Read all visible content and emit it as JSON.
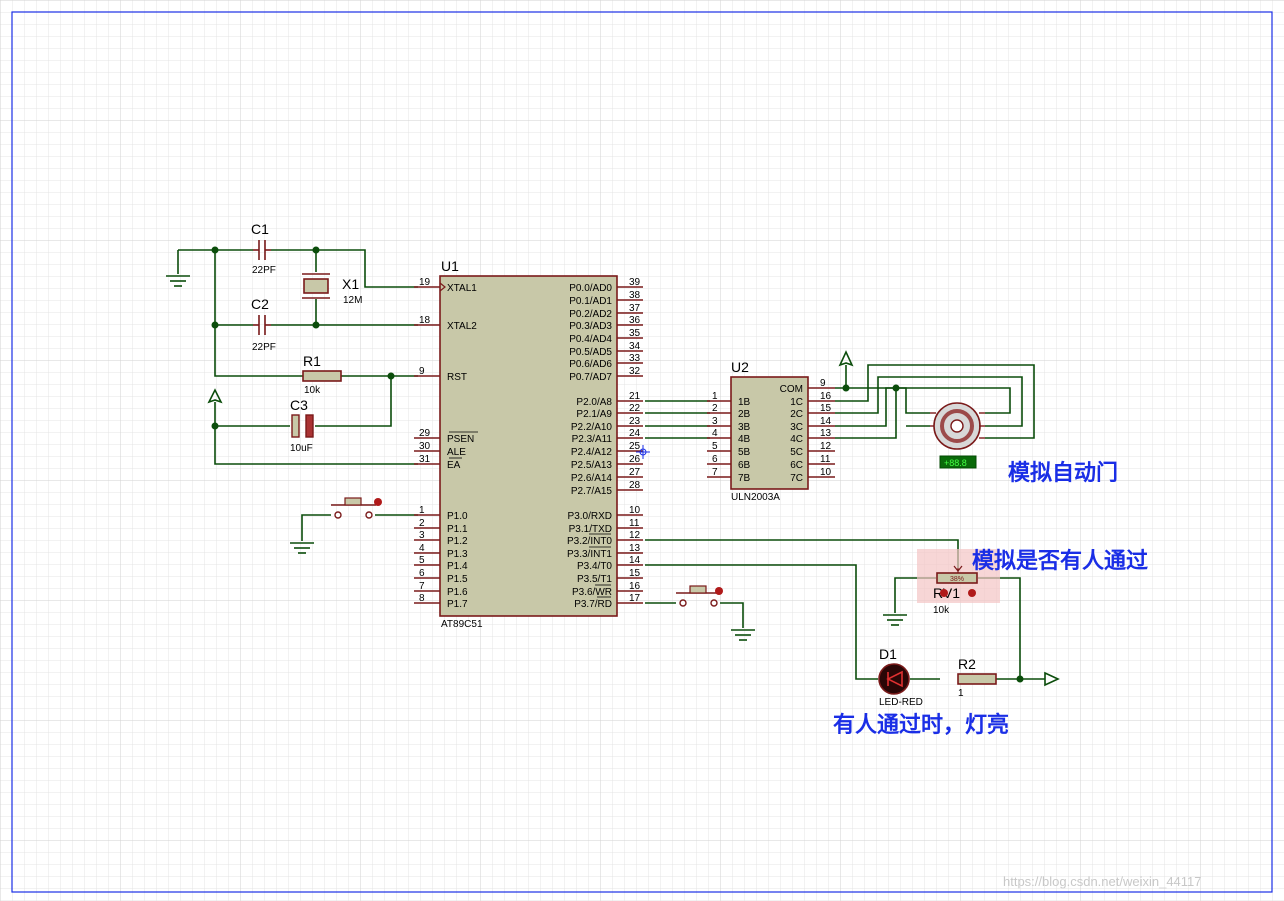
{
  "components": {
    "c1": {
      "ref": "C1",
      "value": "22PF"
    },
    "c2": {
      "ref": "C2",
      "value": "22PF"
    },
    "x1": {
      "ref": "X1",
      "value": "12M"
    },
    "r1": {
      "ref": "R1",
      "value": "10k"
    },
    "c3": {
      "ref": "C3",
      "value": "10uF"
    },
    "u1": {
      "ref": "U1",
      "value": "AT89C51"
    },
    "u2": {
      "ref": "U2",
      "value": "ULN2003A"
    },
    "rv1": {
      "ref": "RV1",
      "value": "10k",
      "wiper": "38%"
    },
    "d1": {
      "ref": "D1",
      "value": "LED-RED"
    },
    "r2": {
      "ref": "R2",
      "value": "1"
    },
    "motor": {
      "display": "+88.8"
    }
  },
  "u1": {
    "left_pins": [
      {
        "num": "19",
        "name": "XTAL1"
      },
      {
        "num": "18",
        "name": "XTAL2"
      },
      {
        "num": "9",
        "name": "RST"
      },
      {
        "num": "29",
        "name": "PSEN"
      },
      {
        "num": "30",
        "name": "ALE"
      },
      {
        "num": "31",
        "name": "EA"
      },
      {
        "num": "1",
        "name": "P1.0"
      },
      {
        "num": "2",
        "name": "P1.1"
      },
      {
        "num": "3",
        "name": "P1.2"
      },
      {
        "num": "4",
        "name": "P1.3"
      },
      {
        "num": "5",
        "name": "P1.4"
      },
      {
        "num": "6",
        "name": "P1.5"
      },
      {
        "num": "7",
        "name": "P1.6"
      },
      {
        "num": "8",
        "name": "P1.7"
      }
    ],
    "right_pins": [
      {
        "num": "39",
        "name": "P0.0/AD0"
      },
      {
        "num": "38",
        "name": "P0.1/AD1"
      },
      {
        "num": "37",
        "name": "P0.2/AD2"
      },
      {
        "num": "36",
        "name": "P0.3/AD3"
      },
      {
        "num": "35",
        "name": "P0.4/AD4"
      },
      {
        "num": "34",
        "name": "P0.5/AD5"
      },
      {
        "num": "33",
        "name": "P0.6/AD6"
      },
      {
        "num": "32",
        "name": "P0.7/AD7"
      },
      {
        "num": "21",
        "name": "P2.0/A8"
      },
      {
        "num": "22",
        "name": "P2.1/A9"
      },
      {
        "num": "23",
        "name": "P2.2/A10"
      },
      {
        "num": "24",
        "name": "P2.3/A11"
      },
      {
        "num": "25",
        "name": "P2.4/A12"
      },
      {
        "num": "26",
        "name": "P2.5/A13"
      },
      {
        "num": "27",
        "name": "P2.6/A14"
      },
      {
        "num": "28",
        "name": "P2.7/A15"
      },
      {
        "num": "10",
        "name": "P3.0/RXD"
      },
      {
        "num": "11",
        "name": "P3.1/TXD"
      },
      {
        "num": "12",
        "name": "P3.2/INT0"
      },
      {
        "num": "13",
        "name": "P3.3/INT1"
      },
      {
        "num": "14",
        "name": "P3.4/T0"
      },
      {
        "num": "15",
        "name": "P3.5/T1"
      },
      {
        "num": "16",
        "name": "P3.6/WR"
      },
      {
        "num": "17",
        "name": "P3.7/RD"
      }
    ]
  },
  "u2": {
    "left_pins": [
      {
        "num": "1",
        "name": "1B"
      },
      {
        "num": "2",
        "name": "2B"
      },
      {
        "num": "3",
        "name": "3B"
      },
      {
        "num": "4",
        "name": "4B"
      },
      {
        "num": "5",
        "name": "5B"
      },
      {
        "num": "6",
        "name": "6B"
      },
      {
        "num": "7",
        "name": "7B"
      }
    ],
    "right_pins": [
      {
        "num": "9",
        "name": "COM"
      },
      {
        "num": "16",
        "name": "1C"
      },
      {
        "num": "15",
        "name": "2C"
      },
      {
        "num": "14",
        "name": "3C"
      },
      {
        "num": "13",
        "name": "4C"
      },
      {
        "num": "12",
        "name": "5C"
      },
      {
        "num": "11",
        "name": "6C"
      },
      {
        "num": "10",
        "name": "7C"
      }
    ]
  },
  "annotations": {
    "door": "模拟自动门",
    "person": "模拟是否有人通过",
    "light": "有人通过时，灯亮"
  },
  "watermark": "https://blog.csdn.net/weixin_44117"
}
